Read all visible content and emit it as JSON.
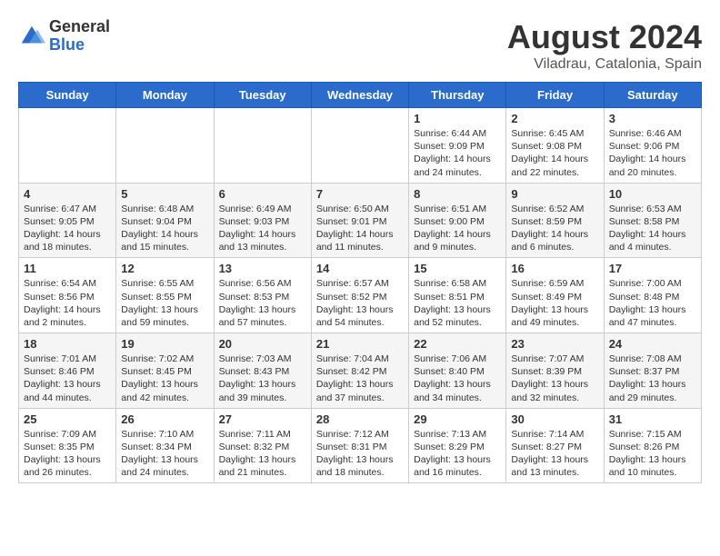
{
  "header": {
    "logo_general": "General",
    "logo_blue": "Blue",
    "title": "August 2024",
    "location": "Viladrau, Catalonia, Spain"
  },
  "days_of_week": [
    "Sunday",
    "Monday",
    "Tuesday",
    "Wednesday",
    "Thursday",
    "Friday",
    "Saturday"
  ],
  "weeks": [
    [
      {
        "day": "",
        "info": ""
      },
      {
        "day": "",
        "info": ""
      },
      {
        "day": "",
        "info": ""
      },
      {
        "day": "",
        "info": ""
      },
      {
        "day": "1",
        "info": "Sunrise: 6:44 AM\nSunset: 9:09 PM\nDaylight: 14 hours\nand 24 minutes."
      },
      {
        "day": "2",
        "info": "Sunrise: 6:45 AM\nSunset: 9:08 PM\nDaylight: 14 hours\nand 22 minutes."
      },
      {
        "day": "3",
        "info": "Sunrise: 6:46 AM\nSunset: 9:06 PM\nDaylight: 14 hours\nand 20 minutes."
      }
    ],
    [
      {
        "day": "4",
        "info": "Sunrise: 6:47 AM\nSunset: 9:05 PM\nDaylight: 14 hours\nand 18 minutes."
      },
      {
        "day": "5",
        "info": "Sunrise: 6:48 AM\nSunset: 9:04 PM\nDaylight: 14 hours\nand 15 minutes."
      },
      {
        "day": "6",
        "info": "Sunrise: 6:49 AM\nSunset: 9:03 PM\nDaylight: 14 hours\nand 13 minutes."
      },
      {
        "day": "7",
        "info": "Sunrise: 6:50 AM\nSunset: 9:01 PM\nDaylight: 14 hours\nand 11 minutes."
      },
      {
        "day": "8",
        "info": "Sunrise: 6:51 AM\nSunset: 9:00 PM\nDaylight: 14 hours\nand 9 minutes."
      },
      {
        "day": "9",
        "info": "Sunrise: 6:52 AM\nSunset: 8:59 PM\nDaylight: 14 hours\nand 6 minutes."
      },
      {
        "day": "10",
        "info": "Sunrise: 6:53 AM\nSunset: 8:58 PM\nDaylight: 14 hours\nand 4 minutes."
      }
    ],
    [
      {
        "day": "11",
        "info": "Sunrise: 6:54 AM\nSunset: 8:56 PM\nDaylight: 14 hours\nand 2 minutes."
      },
      {
        "day": "12",
        "info": "Sunrise: 6:55 AM\nSunset: 8:55 PM\nDaylight: 13 hours\nand 59 minutes."
      },
      {
        "day": "13",
        "info": "Sunrise: 6:56 AM\nSunset: 8:53 PM\nDaylight: 13 hours\nand 57 minutes."
      },
      {
        "day": "14",
        "info": "Sunrise: 6:57 AM\nSunset: 8:52 PM\nDaylight: 13 hours\nand 54 minutes."
      },
      {
        "day": "15",
        "info": "Sunrise: 6:58 AM\nSunset: 8:51 PM\nDaylight: 13 hours\nand 52 minutes."
      },
      {
        "day": "16",
        "info": "Sunrise: 6:59 AM\nSunset: 8:49 PM\nDaylight: 13 hours\nand 49 minutes."
      },
      {
        "day": "17",
        "info": "Sunrise: 7:00 AM\nSunset: 8:48 PM\nDaylight: 13 hours\nand 47 minutes."
      }
    ],
    [
      {
        "day": "18",
        "info": "Sunrise: 7:01 AM\nSunset: 8:46 PM\nDaylight: 13 hours\nand 44 minutes."
      },
      {
        "day": "19",
        "info": "Sunrise: 7:02 AM\nSunset: 8:45 PM\nDaylight: 13 hours\nand 42 minutes."
      },
      {
        "day": "20",
        "info": "Sunrise: 7:03 AM\nSunset: 8:43 PM\nDaylight: 13 hours\nand 39 minutes."
      },
      {
        "day": "21",
        "info": "Sunrise: 7:04 AM\nSunset: 8:42 PM\nDaylight: 13 hours\nand 37 minutes."
      },
      {
        "day": "22",
        "info": "Sunrise: 7:06 AM\nSunset: 8:40 PM\nDaylight: 13 hours\nand 34 minutes."
      },
      {
        "day": "23",
        "info": "Sunrise: 7:07 AM\nSunset: 8:39 PM\nDaylight: 13 hours\nand 32 minutes."
      },
      {
        "day": "24",
        "info": "Sunrise: 7:08 AM\nSunset: 8:37 PM\nDaylight: 13 hours\nand 29 minutes."
      }
    ],
    [
      {
        "day": "25",
        "info": "Sunrise: 7:09 AM\nSunset: 8:35 PM\nDaylight: 13 hours\nand 26 minutes."
      },
      {
        "day": "26",
        "info": "Sunrise: 7:10 AM\nSunset: 8:34 PM\nDaylight: 13 hours\nand 24 minutes."
      },
      {
        "day": "27",
        "info": "Sunrise: 7:11 AM\nSunset: 8:32 PM\nDaylight: 13 hours\nand 21 minutes."
      },
      {
        "day": "28",
        "info": "Sunrise: 7:12 AM\nSunset: 8:31 PM\nDaylight: 13 hours\nand 18 minutes."
      },
      {
        "day": "29",
        "info": "Sunrise: 7:13 AM\nSunset: 8:29 PM\nDaylight: 13 hours\nand 16 minutes."
      },
      {
        "day": "30",
        "info": "Sunrise: 7:14 AM\nSunset: 8:27 PM\nDaylight: 13 hours\nand 13 minutes."
      },
      {
        "day": "31",
        "info": "Sunrise: 7:15 AM\nSunset: 8:26 PM\nDaylight: 13 hours\nand 10 minutes."
      }
    ]
  ]
}
